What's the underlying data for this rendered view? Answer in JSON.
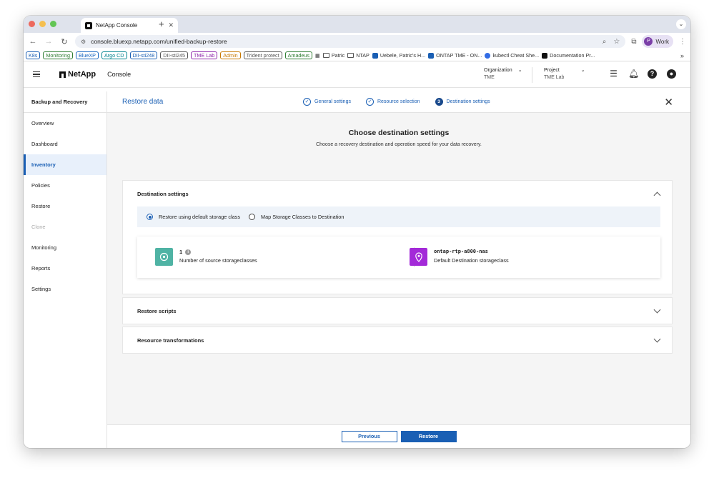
{
  "browser": {
    "tab_title": "NetApp Console",
    "tab_close": "✕",
    "new_tab": "+",
    "url": "console.bluexp.netapp.com/unified-backup-restore",
    "profile_initial": "P",
    "profile_label": "Work",
    "bookmarks_more": "»",
    "bookmarks_chips": [
      {
        "label": "K8s",
        "color": "#1a5fb4"
      },
      {
        "label": "Monitoring",
        "color": "#2e7d32"
      },
      {
        "label": "BlueXP",
        "color": "#1565c0"
      },
      {
        "label": "Argo CD",
        "color": "#00838f"
      },
      {
        "label": "DII-sti248",
        "color": "#1a5fb4"
      },
      {
        "label": "DII-sti245",
        "color": "#555555"
      },
      {
        "label": "TME Lab",
        "color": "#8e24aa"
      },
      {
        "label": "Admin",
        "color": "#c77800"
      },
      {
        "label": "Trident protect",
        "color": "#555555"
      },
      {
        "label": "Amadeus",
        "color": "#2e7d32"
      }
    ],
    "bookmarks_plain": {
      "patric": "Patric",
      "ntap": "NTAP",
      "uebele": "Uebele, Patric's H...",
      "ontap": "ONTAP TME - ON...",
      "kubectl": "kubectl Cheat She...",
      "documentation": "Documentation Pr..."
    }
  },
  "header": {
    "logo": "NetApp",
    "console_label": "Console",
    "organization_label": "Organization",
    "organization_value": "TME",
    "project_label": "Project",
    "project_value": "TME Lab"
  },
  "sidebar": {
    "title": "Backup and Recovery",
    "items": {
      "overview": "Overview",
      "dashboard": "Dashboard",
      "inventory": "Inventory",
      "policies": "Policies",
      "restore": "Restore",
      "clone": "Clone",
      "monitoring": "Monitoring",
      "reports": "Reports",
      "settings": "Settings"
    }
  },
  "wizard": {
    "title": "Restore data",
    "step1": "General settings",
    "step2": "Resource selection",
    "step3_number": "3",
    "step3": "Destination settings"
  },
  "main": {
    "heading": "Choose destination settings",
    "subheading": "Choose a recovery destination and operation speed for your data recovery.",
    "destination_panel": {
      "title": "Destination settings",
      "option_default": "Restore using default storage class",
      "option_map": "Map Storage Classes to Destination",
      "source_count": "1",
      "source_label": "Number of source storageclasses",
      "dest_value": "ontap-rtp-a800-nas",
      "dest_label": "Default Destination storageclass"
    },
    "scripts_panel_title": "Restore scripts",
    "transform_panel_title": "Resource transformations"
  },
  "footer": {
    "previous": "Previous",
    "restore": "Restore"
  },
  "colors": {
    "accent": "#1a5fb4",
    "stat_teal": "#4fb3a4",
    "stat_purple": "#a32ad8"
  }
}
